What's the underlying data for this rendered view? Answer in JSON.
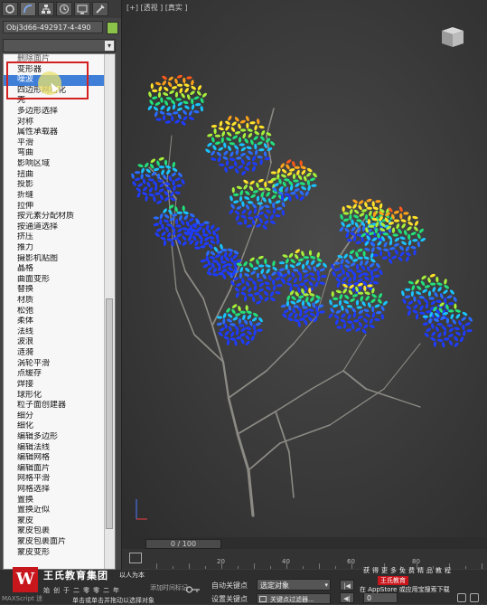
{
  "panel": {
    "object_name": "Obj3d66-492917-4-490",
    "object_color": "#8bc34a",
    "tabs": [
      "create-icon",
      "modify-icon",
      "hierarchy-icon",
      "motion-icon",
      "display-icon",
      "utilities-icon"
    ],
    "modifier_list": {
      "items": [
        {
          "label": "删除面片",
          "selected": false
        },
        {
          "label": "变形器",
          "selected": false
        },
        {
          "label": "噪波",
          "selected": true
        },
        {
          "label": "四边形网格化",
          "selected": false
        },
        {
          "label": "壳",
          "selected": false
        },
        {
          "label": "多边形选择",
          "selected": false
        },
        {
          "label": "对称",
          "selected": false
        },
        {
          "label": "属性承载器",
          "selected": false
        },
        {
          "label": "平滑",
          "selected": false
        },
        {
          "label": "弯曲",
          "selected": false
        },
        {
          "label": "影响区域",
          "selected": false
        },
        {
          "label": "扭曲",
          "selected": false
        },
        {
          "label": "投影",
          "selected": false
        },
        {
          "label": "折缝",
          "selected": false
        },
        {
          "label": "拉伸",
          "selected": false
        },
        {
          "label": "按元素分配材质",
          "selected": false
        },
        {
          "label": "按通道选择",
          "selected": false
        },
        {
          "label": "挤压",
          "selected": false
        },
        {
          "label": "推力",
          "selected": false
        },
        {
          "label": "摄影机贴图",
          "selected": false
        },
        {
          "label": "晶格",
          "selected": false
        },
        {
          "label": "曲面变形",
          "selected": false
        },
        {
          "label": "替换",
          "selected": false
        },
        {
          "label": "材质",
          "selected": false
        },
        {
          "label": "松弛",
          "selected": false
        },
        {
          "label": "柔体",
          "selected": false
        },
        {
          "label": "法线",
          "selected": false
        },
        {
          "label": "波浪",
          "selected": false
        },
        {
          "label": "涟漪",
          "selected": false
        },
        {
          "label": "涡轮平滑",
          "selected": false
        },
        {
          "label": "点缓存",
          "selected": false
        },
        {
          "label": "焊接",
          "selected": false
        },
        {
          "label": "球形化",
          "selected": false
        },
        {
          "label": "粒子面创建器",
          "selected": false
        },
        {
          "label": "细分",
          "selected": false
        },
        {
          "label": "细化",
          "selected": false
        },
        {
          "label": "编辑多边形",
          "selected": false
        },
        {
          "label": "编辑法线",
          "selected": false
        },
        {
          "label": "编辑网格",
          "selected": false
        },
        {
          "label": "编辑面片",
          "selected": false
        },
        {
          "label": "网格平滑",
          "selected": false
        },
        {
          "label": "网格选择",
          "selected": false
        },
        {
          "label": "置换",
          "selected": false
        },
        {
          "label": "置换近似",
          "selected": false
        },
        {
          "label": "蒙皮",
          "selected": false
        },
        {
          "label": "蒙皮包裹",
          "selected": false
        },
        {
          "label": "蒙皮包裹面片",
          "selected": false
        },
        {
          "label": "蒙皮变形",
          "selected": false
        }
      ]
    }
  },
  "viewport": {
    "label": "[+] [透视 ] [真实 ]"
  },
  "timeline": {
    "frame_display": "0 / 100",
    "ticks": [
      "20",
      "40",
      "60",
      "80"
    ]
  },
  "bottom": {
    "maxscript": "MAXScript 迷",
    "status_message": "单击或单击并拖动以选择对象",
    "add_time_tag": "添加时间标记",
    "auto_key": "自动关键点",
    "set_key": "设置关键点",
    "selection_dropdown": "选定对象",
    "key_filters": "关键点过滤器...",
    "frame_value": "0",
    "brand": "王氏教育集团",
    "brand_sub": "始创于二零零二年",
    "slogan": "以人为本",
    "promo_line1": "获得更多免费精品教程",
    "promo_badge": "王氏教育",
    "promo_line2": "在 AppStore 或应用宝搜索下载"
  },
  "colors": {
    "selection_highlight": "#3f7fd8",
    "annotation_box": "#d42020",
    "brand_red": "#c8161d"
  }
}
